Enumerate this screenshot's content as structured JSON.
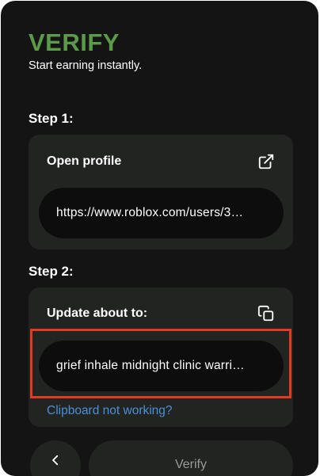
{
  "header": {
    "title": "VERIFY",
    "subtitle": "Start earning instantly."
  },
  "step1": {
    "label": "Step 1:",
    "heading": "Open profile",
    "icon": "external-link-icon",
    "url": "https://www.roblox.com/users/3…"
  },
  "step2": {
    "label": "Step 2:",
    "heading": "Update about to:",
    "icon": "copy-icon",
    "phrase": "grief inhale midnight clinic warri…",
    "link": "Clipboard not working?"
  },
  "footer": {
    "back_icon": "chevron-left-icon",
    "verify_label": "Verify"
  },
  "colors": {
    "accent": "#5b9a49",
    "link": "#4a90d9",
    "highlight": "#e33a20",
    "background": "#141414",
    "card": "#222422"
  }
}
